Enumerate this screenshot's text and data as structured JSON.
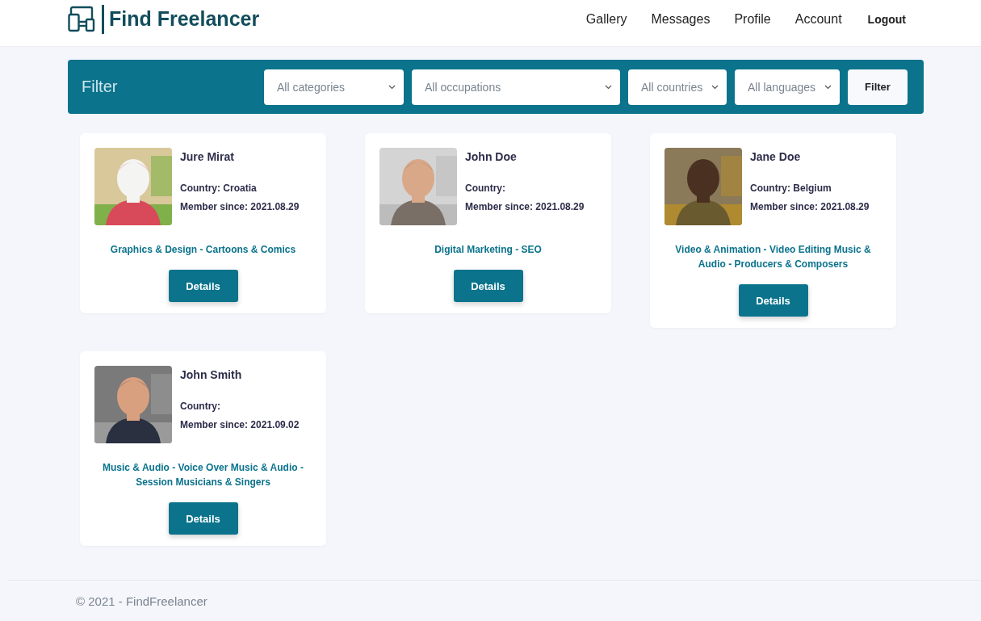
{
  "header": {
    "logo": "Find Freelancer",
    "nav": [
      {
        "label": "Gallery"
      },
      {
        "label": "Messages"
      },
      {
        "label": "Profile"
      },
      {
        "label": "Account"
      },
      {
        "label": "Logout",
        "kind": "bold"
      }
    ]
  },
  "filter": {
    "title": "Filter",
    "selects": [
      {
        "placeholder": "All categories"
      },
      {
        "placeholder": "All occupations"
      },
      {
        "placeholder": "All countries"
      },
      {
        "placeholder": "All languages"
      }
    ],
    "button": "Filter"
  },
  "freelancers": [
    {
      "name": "Jure Mirat",
      "country": "Country: Croatia",
      "member_since": "Member since: 2021.08.29",
      "skills": "Graphics & Design - Cartoons & Comics",
      "button": "Details"
    },
    {
      "name": "John Doe",
      "country": "Country:",
      "member_since": "Member since: 2021.08.29",
      "skills": "Digital Marketing - SEO",
      "button": "Details"
    },
    {
      "name": "Jane Doe",
      "country": "Country: Belgium",
      "member_since": "Member since: 2021.08.29",
      "skills": "Video & Animation - Video Editing Music & Audio - Producers & Composers",
      "button": "Details"
    },
    {
      "name": "John Smith",
      "country": "Country:",
      "member_since": "Member since: 2021.09.02",
      "skills": "Music & Audio - Voice Over Music & Audio - Session Musicians & Singers",
      "button": "Details"
    }
  ],
  "footer": "© 2021 - FindFreelancer"
}
